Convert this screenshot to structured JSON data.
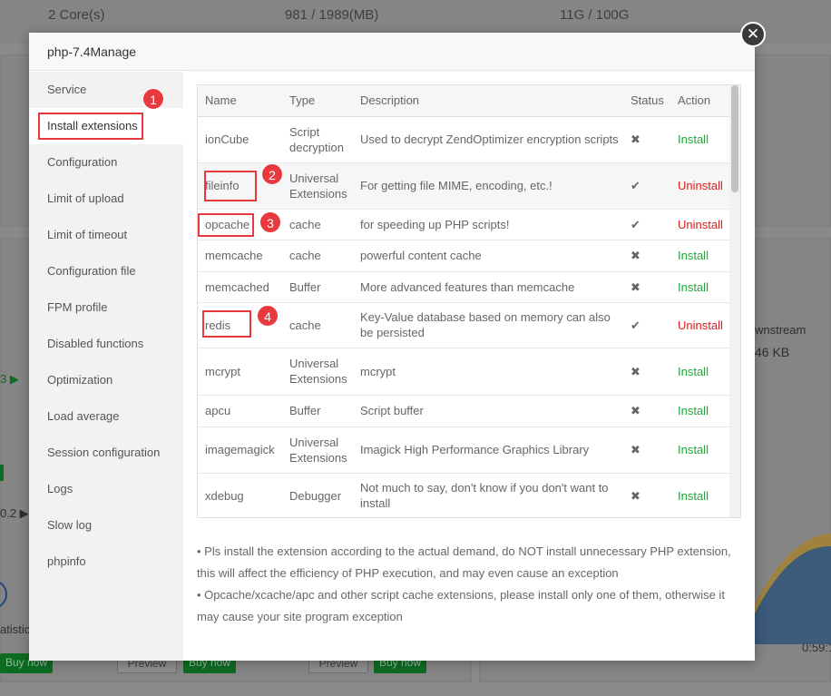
{
  "background": {
    "stats": [
      "2 Core(s)",
      "981 / 1989(MB)",
      "11G / 100G"
    ],
    "downstream_label": "wnstream",
    "downstream_value": "46 KB",
    "statistic_label": "atistic",
    "time_label": "0:59:1",
    "left_values": [
      "3 ▶",
      "0.2 ▶"
    ],
    "buttons": [
      "Preview",
      "Buy now"
    ]
  },
  "modal": {
    "title": "php-7.4Manage",
    "close_glyph": "✕"
  },
  "sidebar": {
    "items": [
      {
        "label": "Service"
      },
      {
        "label": "Install extensions"
      },
      {
        "label": "Configuration"
      },
      {
        "label": "Limit of upload"
      },
      {
        "label": "Limit of timeout"
      },
      {
        "label": "Configuration file"
      },
      {
        "label": "FPM profile"
      },
      {
        "label": "Disabled functions"
      },
      {
        "label": "Optimization"
      },
      {
        "label": "Load average"
      },
      {
        "label": "Session configuration"
      },
      {
        "label": "Logs"
      },
      {
        "label": "Slow log"
      },
      {
        "label": "phpinfo"
      }
    ]
  },
  "table": {
    "headers": {
      "name": "Name",
      "type": "Type",
      "description": "Description",
      "status": "Status",
      "action": "Action"
    },
    "rows": [
      {
        "name": "ionCube",
        "type": "Script decryption",
        "description": "Used to decrypt ZendOptimizer encryption scripts",
        "status": "✖",
        "action": "Install"
      },
      {
        "name": "fileinfo",
        "type": "Universal Extensions",
        "description": "For getting file MIME, encoding, etc.!",
        "status": "✔",
        "action": "Uninstall"
      },
      {
        "name": "opcache",
        "type": "cache",
        "description": "for speeding up PHP scripts!",
        "status": "✔",
        "action": "Uninstall"
      },
      {
        "name": "memcache",
        "type": "cache",
        "description": "powerful content cache",
        "status": "✖",
        "action": "Install"
      },
      {
        "name": "memcached",
        "type": "Buffer",
        "description": "More advanced features than memcache",
        "status": "✖",
        "action": "Install"
      },
      {
        "name": "redis",
        "type": "cache",
        "description": "Key-Value database based on memory can also be persisted",
        "status": "✔",
        "action": "Uninstall"
      },
      {
        "name": "mcrypt",
        "type": "Universal Extensions",
        "description": "mcrypt",
        "status": "✖",
        "action": "Install"
      },
      {
        "name": "apcu",
        "type": "Buffer",
        "description": "Script buffer",
        "status": "✖",
        "action": "Install"
      },
      {
        "name": "imagemagick",
        "type": "Universal Extensions",
        "description": "Imagick High Performance Graphics Library",
        "status": "✖",
        "action": "Install"
      },
      {
        "name": "xdebug",
        "type": "Debugger",
        "description": "Not much to say, don't know if you don't want to install",
        "status": "✖",
        "action": "Install"
      }
    ]
  },
  "notes": [
    "• Pls install the extension according to the actual demand, do NOT install unnecessary PHP extension, this will affect the efficiency of PHP execution, and may even cause an exception",
    "• Opcache/xcache/apc and other script cache extensions, please install only one of them, otherwise it may cause your site program exception"
  ],
  "annotations": [
    "1",
    "2",
    "3",
    "4"
  ],
  "colors": {
    "install": "#20a53a",
    "uninstall": "#e21c1c",
    "annotation": "#e8393f"
  }
}
